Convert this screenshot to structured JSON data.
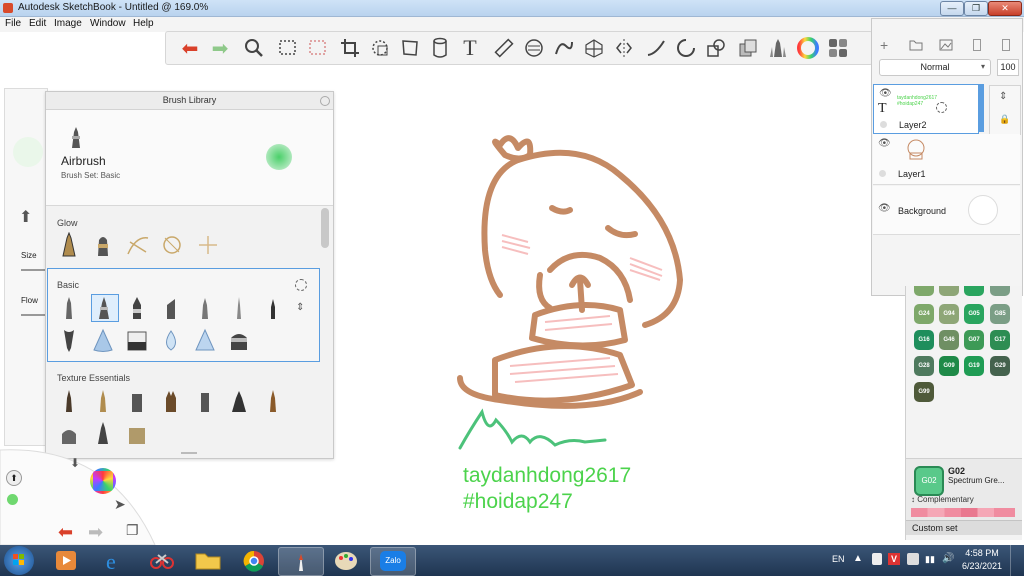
{
  "window": {
    "title": "Autodesk SketchBook - Untitled @ 169.0%"
  },
  "menu": {
    "items": [
      "File",
      "Edit",
      "Image",
      "Window",
      "Help"
    ]
  },
  "toolbar": {
    "tools": [
      "undo-icon",
      "redo-icon",
      "zoom-icon",
      "rect-select-icon",
      "lasso-select-icon",
      "crop-icon",
      "transform-icon",
      "distort-icon",
      "fill-icon",
      "text-icon",
      "ruler-icon",
      "ellipse-guide-icon",
      "french-curve-icon",
      "perspective-icon",
      "symmetry-icon",
      "stroke-icon",
      "shape-icon",
      "shape-combine-icon",
      "copy-brush-icon",
      "brush-icon",
      "color-wheel-icon",
      "swatches-icon"
    ]
  },
  "brush_library": {
    "title": "Brush Library",
    "selected_brush": {
      "name": "Airbrush",
      "set": "Brush Set: Basic"
    },
    "sections": {
      "glow": "Glow",
      "basic": "Basic",
      "texture": "Texture Essentials"
    }
  },
  "left_panel": {
    "size_label": "Size",
    "flow_label": "Flow"
  },
  "layers": {
    "blend_mode": "Normal",
    "opacity": "100",
    "items": [
      {
        "name": "Layer2",
        "thumb_text": "taydanhdong2617 #hoidap247"
      },
      {
        "name": "Layer1"
      },
      {
        "name": "Background"
      }
    ]
  },
  "swatches": {
    "rows": [
      [
        "G24",
        "G94",
        "G05",
        "G85"
      ],
      [
        "G16",
        "G46",
        "G07",
        "G17"
      ],
      [
        "G28",
        "G09",
        "G19",
        "G29"
      ],
      [
        "G99"
      ]
    ],
    "colors": [
      "#7ea86a",
      "#8ea677",
      "#2aa55f",
      "#7b9e86",
      "#1e8e5c",
      "#6f8f63",
      "#3d9a56",
      "#2d8d53",
      "#4f7a5e",
      "#1f8a48",
      "#1f9c54",
      "#44624d",
      "#4f5a3a"
    ],
    "selected": {
      "code": "G02",
      "name": "Spectrum Gre...",
      "color": "#59c98a"
    },
    "complementary_label": "Complementary",
    "custom_set_label": "Custom set"
  },
  "canvas": {
    "signature_line1": "taydanhdong2617",
    "signature_line2": "#hoidap247"
  },
  "taskbar": {
    "clock_time": "4:58 PM",
    "clock_date": "6/23/2021",
    "lang": "EN",
    "zalo_label": "Zalo"
  },
  "colors": {
    "stroke_brown": "#c58a64",
    "blush_pink": "#f3a3a3",
    "signature_green": "#4cd34c"
  }
}
